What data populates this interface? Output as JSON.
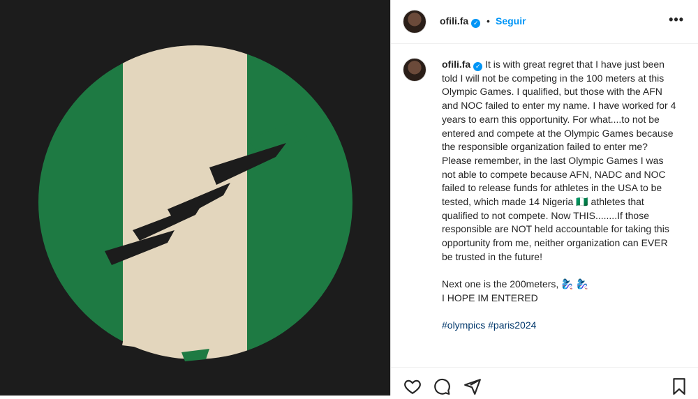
{
  "header": {
    "username": "ofili.fa",
    "separator": "•",
    "follow_label": "Seguir",
    "more_label": "•••",
    "verified_mark": "✓"
  },
  "caption": {
    "username": "ofili.fa",
    "body": "It is with great regret that I have just been told I will not be competing in the 100 meters at this Olympic Games. I qualified, but those with the AFN and NOC failed to enter my name. I have worked for 4 years to earn this opportunity. For what....to not be entered and compete at the Olympic Games because the responsible organization failed to enter me? Please remember, in the last Olympic Games I was not able to compete because AFN, NADC and NOC failed to release funds for athletes in the USA to be tested, which made 14 Nigeria 🇳🇬 athletes that qualified to not compete. Now THIS........If those responsible are NOT held accountable for taking this opportunity from me, neither organization can EVER be trusted in the future!\n\nNext one is the 200meters, 🧞‍♀️ 🧞‍♀️\nI HOPE IM ENTERED\n\n",
    "hashtags": [
      "#olympics",
      "#paris2024"
    ]
  },
  "media": {
    "description_colors": {
      "background": "#1c1c1c",
      "green": "#1e7a43",
      "white_band": "#e3d6bd"
    }
  },
  "actions": {
    "icons": [
      "heart-icon",
      "comment-icon",
      "share-icon",
      "bookmark-icon"
    ]
  }
}
